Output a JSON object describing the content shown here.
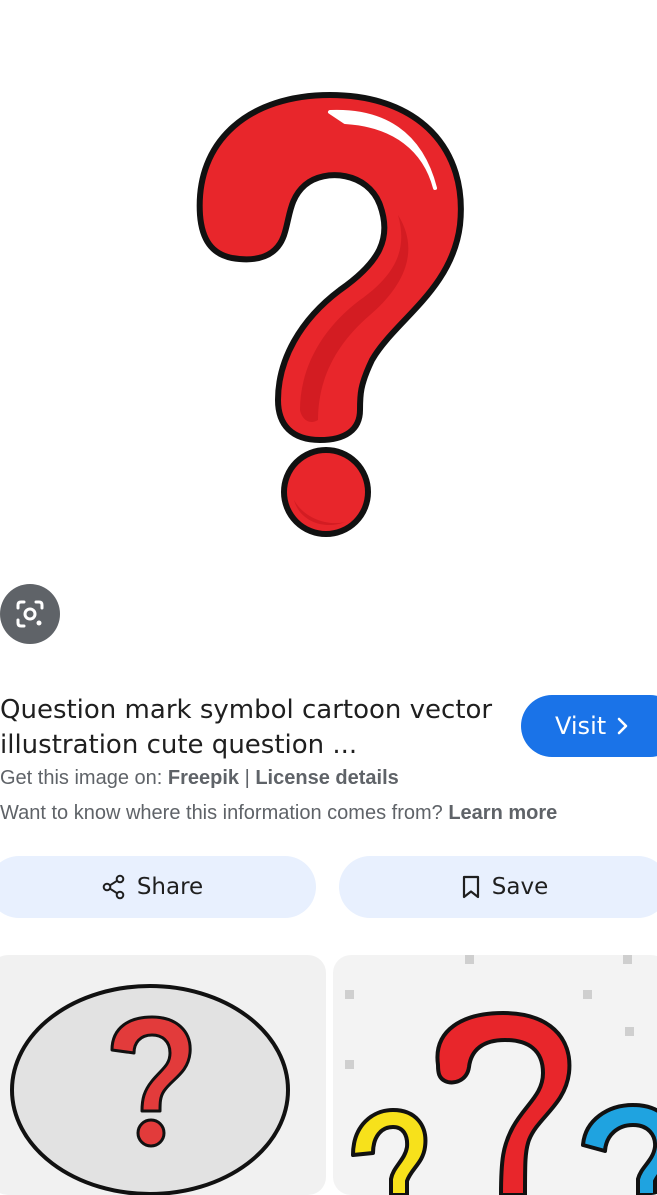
{
  "result": {
    "title": "Question mark symbol cartoon vector\nillustration cute question ...",
    "source_prefix": "Get this image on: ",
    "source_name": "Freepik",
    "separator": " | ",
    "license_label": "License details",
    "info_text": "Want to know where this information comes from? ",
    "learn_more": "Learn more"
  },
  "buttons": {
    "visit_label": "Visit",
    "share_label": "Share",
    "save_label": "Save"
  },
  "icons": {
    "lens": "google-lens-icon",
    "visit_chevron": "chevron-right-icon",
    "share": "share-icon",
    "save": "bookmark-icon"
  },
  "colors": {
    "accent": "#1a73e8",
    "action_bg": "#e8f0fe",
    "question_red": "#e8262b",
    "muted_text": "#5f6368"
  }
}
